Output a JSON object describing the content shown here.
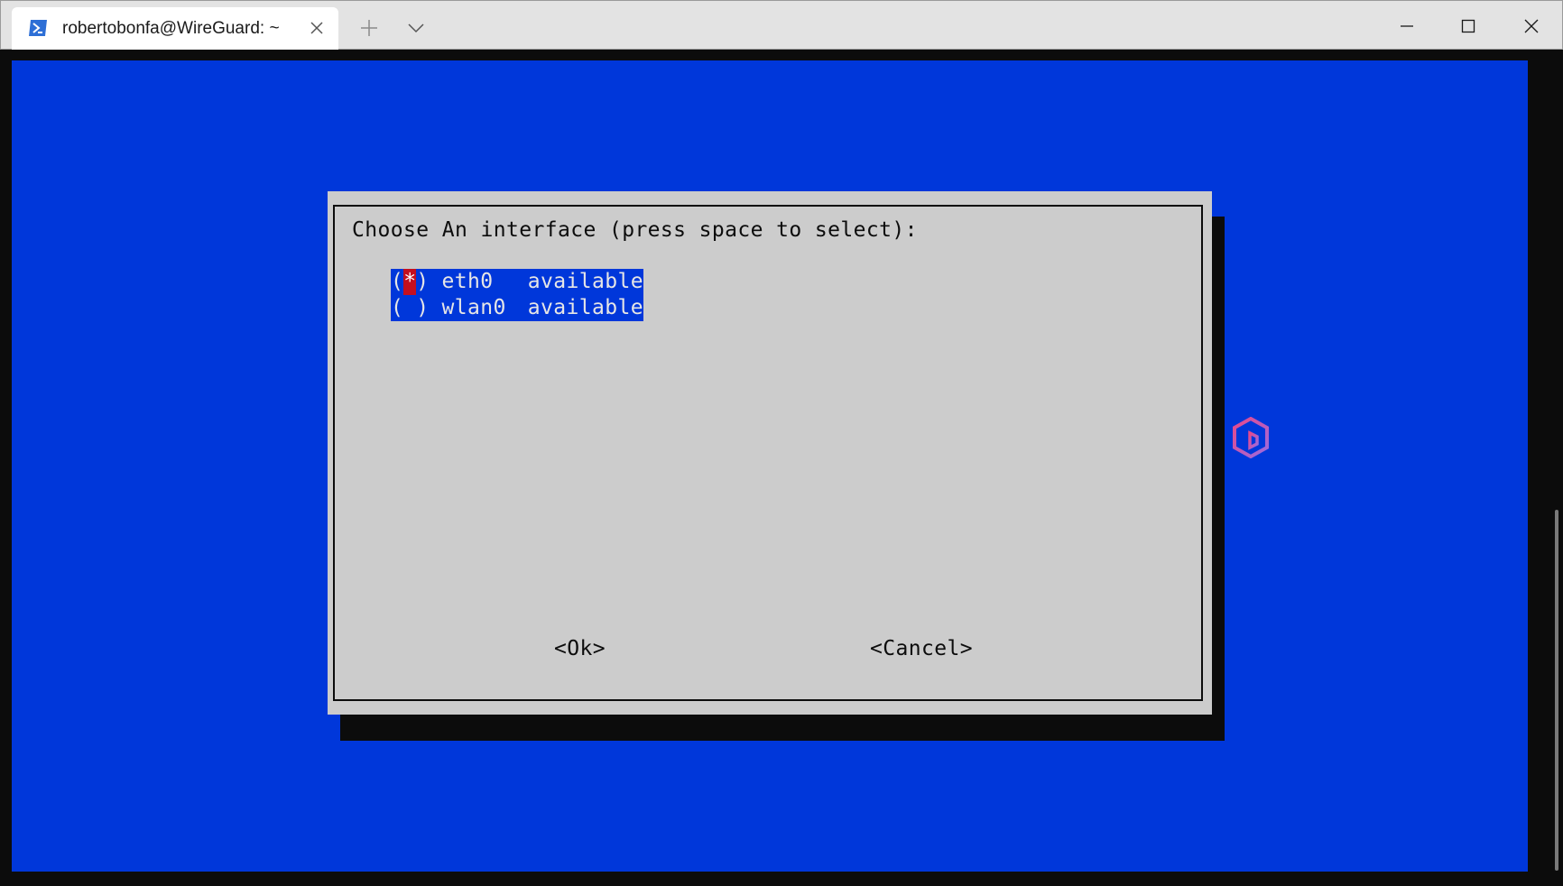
{
  "window": {
    "tab_title": "robertobonfa@WireGuard: ~",
    "tab_icon": "terminal-icon"
  },
  "dialog": {
    "prompt": "Choose An interface (press space to select):",
    "options": [
      {
        "radio_open": "(",
        "mark": "*",
        "radio_close": ")",
        "name": "eth0",
        "status": "available",
        "selected": true
      },
      {
        "radio_open": "(",
        "mark": " ",
        "radio_close": ")",
        "name": "wlan0",
        "status": "available",
        "selected": false
      }
    ],
    "ok_label": "<Ok>",
    "cancel_label": "<Cancel>"
  },
  "colors": {
    "terminal_background": "#0037da",
    "dialog_background": "#cccccc",
    "highlight": "#0037da",
    "selection_mark": "#c50f1f"
  },
  "icons": [
    "terminal-icon",
    "close-icon",
    "plus-icon",
    "chevron-down-icon",
    "minimize-icon",
    "maximize-icon",
    "window-close-icon",
    "watermark-logo"
  ]
}
